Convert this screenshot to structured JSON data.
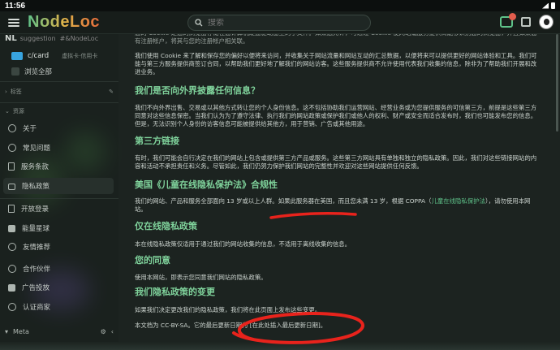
{
  "status": {
    "time": "11:56"
  },
  "header": {
    "logo": "NodeLoc",
    "search_placeholder": "搜索",
    "chat_badge": ""
  },
  "sidebar": {
    "cut_top": {
      "code": "NL",
      "a": "suggestion",
      "b": "#&NodeLoc"
    },
    "card": {
      "title": "c/card",
      "desc": "虚拟卡·信用卡"
    },
    "browse_all": "浏览全部",
    "section_tags": "标签",
    "section_resources": "资源",
    "items": [
      {
        "label": "关于",
        "icon": "info-icon"
      },
      {
        "label": "常见问题",
        "icon": "help-icon"
      },
      {
        "label": "服务条款",
        "icon": "doc-icon"
      },
      {
        "label": "隐私政策",
        "icon": "lock-icon"
      },
      {
        "label": "开放登录",
        "icon": "login-icon"
      },
      {
        "label": "能量星球",
        "icon": "planet-icon"
      },
      {
        "label": "友情推荐",
        "icon": "heart-icon"
      },
      {
        "label": "合作伙伴",
        "icon": "partner-icon"
      },
      {
        "label": "广告投放",
        "icon": "ad-icon"
      },
      {
        "label": "认证商家",
        "icon": "verified-icon"
      }
    ],
    "footer_label": "Meta"
  },
  "content": {
    "p_top": "您的 Cookie 是您的浏览器存储在您计算机硬盘驱动器上的小文件。如果您允许，可通过 Cookie 使网站或服务提供商能够识别您的浏览器，并且如果您有注册帐户，将其与您的注册帐户相关联。",
    "p_cookie": "我们使用 Cookie 来了解和保存您的偏好以便将来访问，并收集关于网站流量和网站互动的汇总数据，以便将来可以提供更好的网站体验和工具。我们可能与第三方服务提供商签订合同，以帮助我们更好地了解我们的网站访客。这些服务提供商不允许使用代表我们收集的信息，除非为了帮助我们开展和改进业务。",
    "h_disclose": "我们是否向外界披露任何信息？",
    "p_disclose": "我们不向外界出售、交易或以其他方式转让您的个人身份信息。这不包括协助我们运营网站、经营业务或为您提供服务的可信第三方，前提是这些第三方同意对这些信息保密。当我们认为为了遵守法律、执行我们的网站政策或保护我们或他人的权利、财产或安全而适合发布时，我们也可能发布您的信息。但是，无法识别个人身份的访客信息可能被提供给其他方，用于营销、广告或其他用途。",
    "h_third": "第三方链接",
    "p_third": "有时，我们可能会自行决定在我们的网站上包含或提供第三方产品或服务。这些第三方网站具有单独和独立的隐私政策。因此，我们对这些链接网站的内容和活动不承担责任和义务。尽管如此，我们仍努力保护我们网站的完整性并欢迎对这些网站提供任何反馈。",
    "h_coppa": "美国《儿童在线隐私保护法》合规性",
    "p_coppa_a": "我们的网站、产品和服务全部面向 13 岁或以上人群。如果此服务器在美国，而且您未满 13 岁，根据 COPPA（",
    "p_coppa_link": "儿童在线隐私保护法",
    "p_coppa_b": "），请勿使用本网站。",
    "h_online": "仅在线隐私政策",
    "p_online": "本在线隐私政策仅适用于通过我们的网站收集的信息，不适用于离线收集的信息。",
    "h_consent": "您的同意",
    "p_consent": "使用本网站，即表示您同意我们网站的隐私政策。",
    "h_changes": "我们隐私政策的变更",
    "p_changes": "如果我们决定更改我们的隐私政策，我们将在此页面上发布这些变更。",
    "p_license": "本文档为 CC-BY-SA。它的最后更新日期为 [在此处插入最后更新日期]。"
  },
  "colors": {
    "accent": "#5fc38a",
    "heading": "#7fd29b",
    "annotation": "#e8231c"
  }
}
